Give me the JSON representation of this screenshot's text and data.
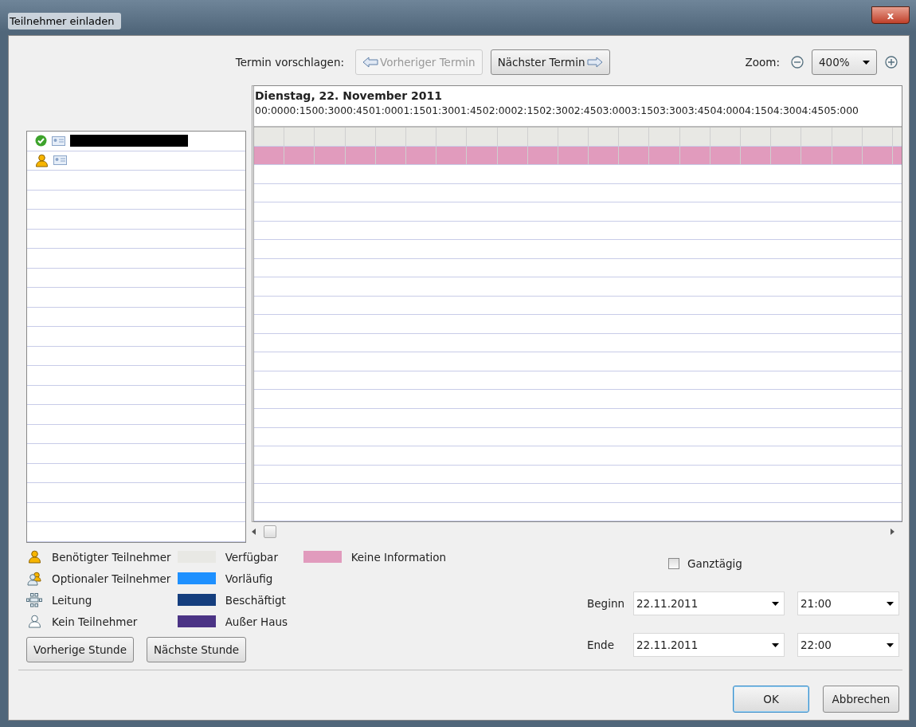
{
  "window": {
    "title": "Teilnehmer einladen",
    "close": "x"
  },
  "toolbar": {
    "suggest_label": "Termin vorschlagen:",
    "prev_button": {
      "label": "Vorheriger Termin",
      "disabled": true
    },
    "next_button": {
      "label": "Nächster Termin",
      "disabled": false
    },
    "zoom_label": "Zoom:",
    "zoom_value": "400%"
  },
  "attendees": [
    {
      "kind": "accepted",
      "name_redacted": true
    },
    {
      "kind": "required",
      "name_redacted": false
    }
  ],
  "timeline": {
    "date": "Dienstag, 22. November 2011",
    "times": [
      "00:00",
      "00:15",
      "00:30",
      "00:45",
      "01:00",
      "01:15",
      "01:30",
      "01:45",
      "02:00",
      "02:15",
      "02:30",
      "02:45",
      "03:00",
      "03:15",
      "03:30",
      "03:45",
      "04:00",
      "04:15",
      "04:30",
      "04:45",
      "05:00",
      "0"
    ],
    "rows": [
      {
        "kind": "available"
      },
      {
        "kind": "no_info"
      }
    ]
  },
  "legend": {
    "roles": [
      {
        "kind": "required",
        "label": "Benötigter Teilnehmer"
      },
      {
        "kind": "optional",
        "label": "Optionaler Teilnehmer"
      },
      {
        "kind": "chair",
        "label": "Leitung"
      },
      {
        "kind": "none",
        "label": "Kein Teilnehmer"
      }
    ],
    "states": [
      {
        "label": "Verfügbar",
        "color": "#e8e8e4"
      },
      {
        "label": "Vorläufig",
        "color": "#1e90ff"
      },
      {
        "label": "Beschäftigt",
        "color": "#153e7e"
      },
      {
        "label": "Außer Haus",
        "color": "#4b3385"
      },
      {
        "label": "Keine Information",
        "color": "#e19bbd"
      }
    ]
  },
  "hour_buttons": [
    "Vorherige Stunde",
    "Nächste Stunde"
  ],
  "all_day": {
    "label": "Ganztägig",
    "checked": false
  },
  "start": {
    "label": "Beginn",
    "date": "22.11.2011",
    "time": "21:00"
  },
  "end": {
    "label": "Ende",
    "date": "22.11.2011",
    "time": "22:00"
  },
  "buttons": [
    {
      "label": "OK",
      "default": true
    },
    {
      "label": "Abbrechen",
      "default": false
    }
  ]
}
